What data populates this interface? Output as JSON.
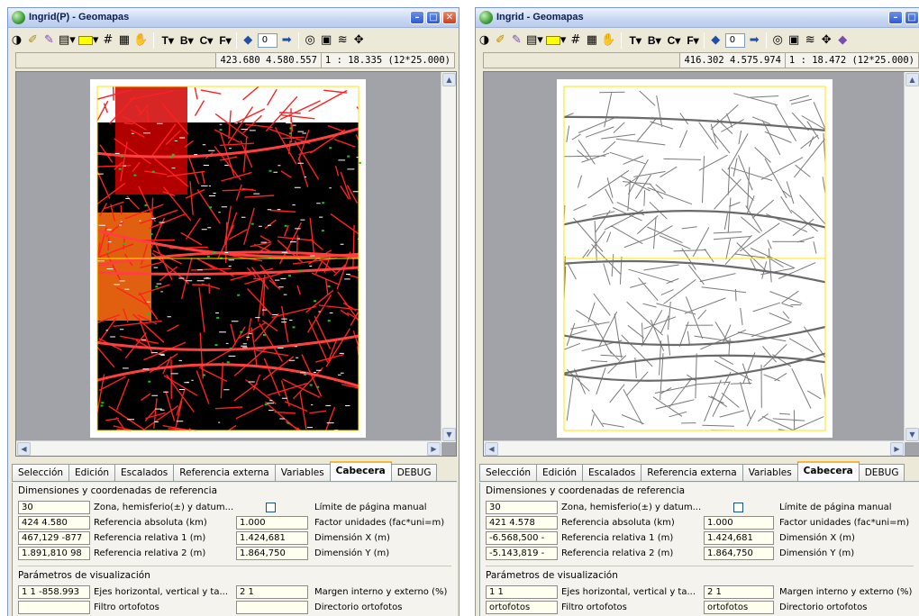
{
  "windows": [
    {
      "title": "Ingrid(P) - Geomapas",
      "status": {
        "coords": "423.680 4.580.557",
        "scale": "1 : 18.335 (12*25.000)"
      },
      "map_style": "red",
      "fields": {
        "zona": "30",
        "ref_abs": "424 4.580",
        "factor_unidades": "1.000",
        "ref_rel1": "467,129 -877",
        "dim_x": "1.424,681",
        "ref_rel2": "1.891,810 98",
        "dim_y": "1.864,750",
        "ejes": "1 1 -858.993",
        "margen": "2 1",
        "filtro": "",
        "directorio": ""
      }
    },
    {
      "title": "Ingrid - Geomapas",
      "status": {
        "coords": "416.302 4.575.974",
        "scale": "1 : 18.472 (12*25.000)"
      },
      "map_style": "gray",
      "fields": {
        "zona": "30",
        "ref_abs": "421 4.578",
        "factor_unidades": "1.000",
        "ref_rel1": "-6.568,500 -",
        "dim_x": "1.424,681",
        "ref_rel2": "-5.143,819 -",
        "dim_y": "1.864,750",
        "ejes": "1 1",
        "margen": "2 1",
        "filtro": "ortofotos",
        "directorio": ""
      }
    }
  ],
  "toolbar": {
    "spin_value": "0",
    "letters": [
      "T",
      "B",
      "C",
      "F"
    ]
  },
  "tabs": [
    "Selección",
    "Edición",
    "Escalados",
    "Referencia externa",
    "Variables",
    "Cabecera",
    "DEBUG"
  ],
  "active_tab": "Cabecera",
  "labels": {
    "section_dimensiones": "Dimensiones y coordenadas de referencia",
    "zona": "Zona, hemisferio(±) y datum...",
    "limite": "Límite de página manual",
    "ref_abs": "Referencia absoluta (km)",
    "factor": "Factor unidades (fac*uni=m)",
    "ref_rel1": "Referencia relativa 1 (m)",
    "dim_x": "Dimensión X (m)",
    "ref_rel2": "Referencia relativa 2 (m)",
    "dim_y": "Dimensión Y (m)",
    "section_parametros": "Parámetros de visualización",
    "ejes": "Ejes horizontal, vertical y ta...",
    "margen": "Margen interno y externo (%)",
    "filtro": "Filtro ortofotos",
    "directorio": "Directorio ortofotos"
  },
  "colors": {
    "titlebar": "#c9d8f2",
    "accent_tab": "#f6b73c",
    "field_bg": "#fffff0",
    "map_red": "#e00000",
    "map_gray": "#808080"
  }
}
